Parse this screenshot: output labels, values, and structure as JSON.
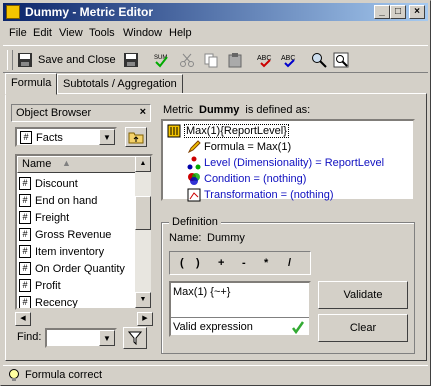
{
  "window": {
    "title": "Dummy - Metric Editor"
  },
  "title_buttons": {
    "minimize": "_",
    "maximize": "□",
    "close": "×"
  },
  "menu": [
    "File",
    "Edit",
    "View",
    "Tools",
    "Window",
    "Help"
  ],
  "toolbar": {
    "save_label": "Save and Close"
  },
  "tabs": [
    "Formula",
    "Subtotals / Aggregation"
  ],
  "object_browser": {
    "title": "Object Browser",
    "folder": "Facts",
    "column_header": "Name",
    "items": [
      "Discount",
      "End on hand",
      "Freight",
      "Gross Revenue",
      "Item inventory",
      "On Order Quantity",
      "Profit",
      "Recency"
    ],
    "find_label": "Find:"
  },
  "definition_header": {
    "prefix": "Metric",
    "metric_name": "Dummy",
    "suffix": "is defined as:"
  },
  "definition_tree": {
    "root": "Max(1){ReportLevel}",
    "children": [
      "Formula = Max(1)",
      "Level (Dimensionality) = ReportLevel",
      "Condition = (nothing)",
      "Transformation = (nothing)"
    ]
  },
  "definition": {
    "group_label": "Definition",
    "name_label": "Name:",
    "name_value": "Dummy",
    "operators": [
      "(",
      ")",
      "+",
      "-",
      "*",
      "/"
    ],
    "expression": "Max(1) {~+}",
    "validation_status": "Valid expression",
    "validate_label": "Validate",
    "clear_label": "Clear"
  },
  "status": {
    "text": "Formula correct"
  }
}
